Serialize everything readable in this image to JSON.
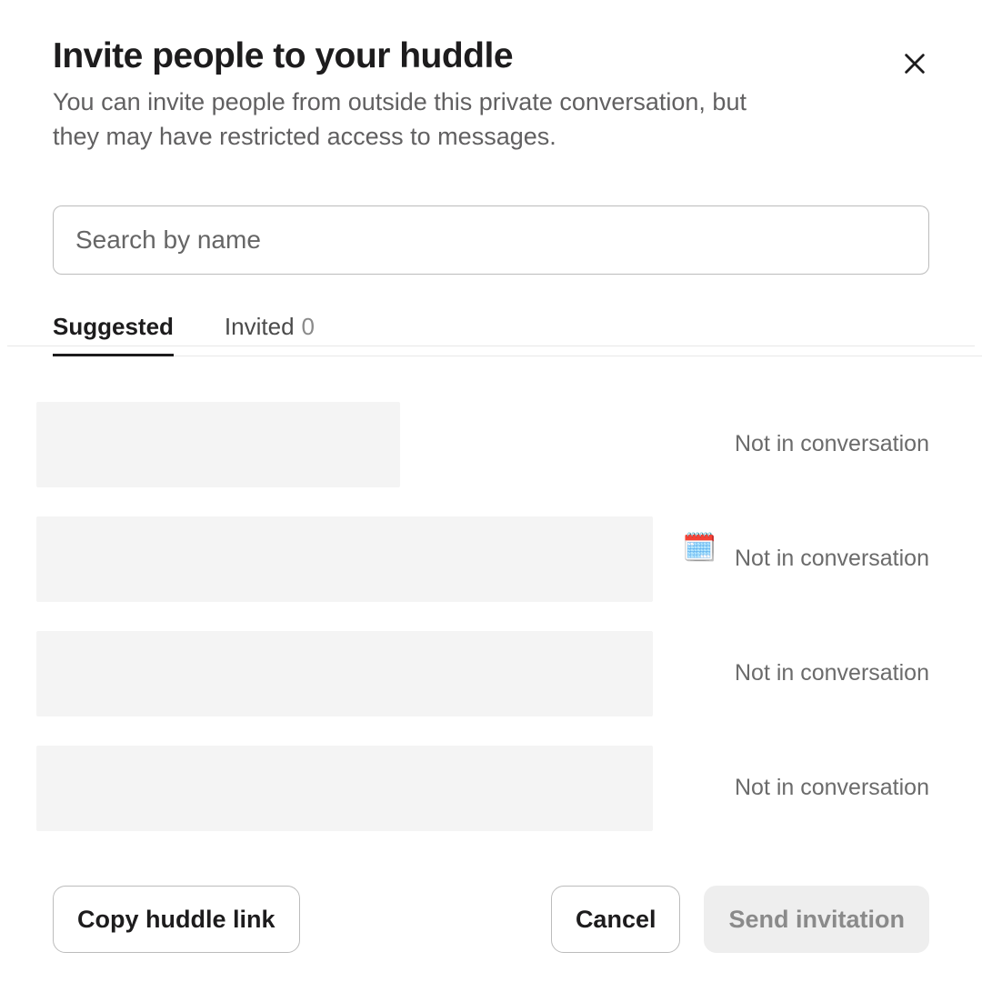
{
  "header": {
    "title": "Invite people to your huddle",
    "subtitle": "You can invite people from outside this private conversation, but they may have restricted access to messages."
  },
  "search": {
    "placeholder": "Search by name",
    "value": ""
  },
  "tabs": {
    "suggested_label": "Suggested",
    "invited_label": "Invited",
    "invited_count": "0",
    "active": "suggested"
  },
  "suggestions": [
    {
      "skeleton_width": 400,
      "status_icon": null,
      "status_text": "Not in conversation"
    },
    {
      "skeleton_width": 678,
      "status_icon": "spiral_calendar",
      "status_text": "Not in conversation"
    },
    {
      "skeleton_width": 678,
      "status_icon": null,
      "status_text": "Not in conversation"
    },
    {
      "skeleton_width": 678,
      "status_icon": null,
      "status_text": "Not in conversation"
    }
  ],
  "footer": {
    "copy_link_label": "Copy huddle link",
    "cancel_label": "Cancel",
    "send_label": "Send invitation"
  },
  "icons": {
    "spiral_calendar": "🗓️"
  }
}
